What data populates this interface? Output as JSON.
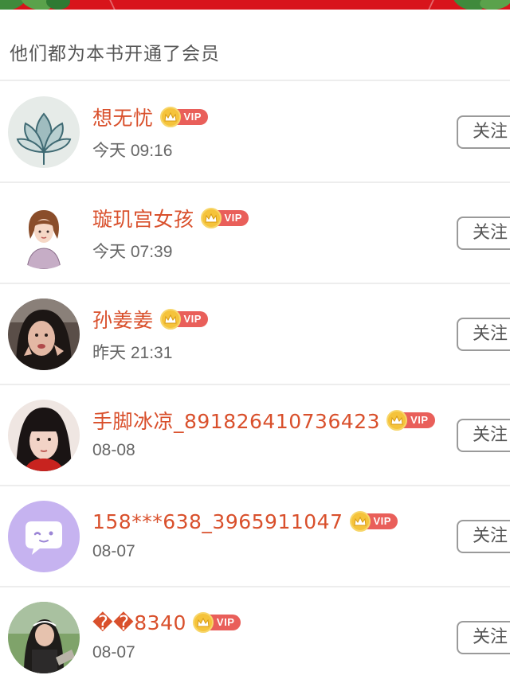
{
  "header": {
    "title": "他们都为本书开通了会员"
  },
  "vip_badge_label": "VIP",
  "colors": {
    "name": "#d9502c",
    "vip_pill": "#e95f5a",
    "vip_crown": "#f5c33b",
    "banner": "#d8141b"
  },
  "members": [
    {
      "name": "想无忧",
      "time": "今天 09:16",
      "follow_label": "关注",
      "avatar_icon": "lotus-ink-avatar"
    },
    {
      "name": "璇玑宫女孩",
      "time": "今天 07:39",
      "follow_label": "关注",
      "avatar_icon": "cartoon-girl-avatar"
    },
    {
      "name": "孙姜姜",
      "time": "昨天 21:31",
      "follow_label": "关注",
      "avatar_icon": "selfie-photo-avatar"
    },
    {
      "name": "手脚冰凉_891826410736423",
      "time": "08-08",
      "follow_label": "关注",
      "avatar_icon": "girl-photo-avatar"
    },
    {
      "name": "158***638_3965911047",
      "time": "08-07",
      "follow_label": "关注",
      "avatar_icon": "default-chat-avatar"
    },
    {
      "name": "��8340",
      "time": "08-07",
      "follow_label": "关注",
      "avatar_icon": "outdoor-photo-avatar"
    }
  ]
}
